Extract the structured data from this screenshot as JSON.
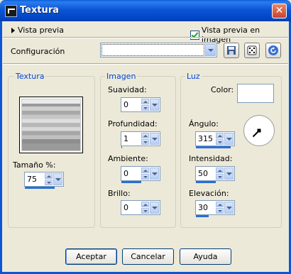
{
  "window": {
    "title": "Textura"
  },
  "header": {
    "preview_label": "Vista previa",
    "image_preview_checkbox_label": "Vista previa en imagen",
    "image_preview_checked": true
  },
  "config": {
    "label": "Configuración",
    "select_value": "",
    "tool_icons": [
      "save-icon",
      "dice-icon",
      "reset-icon"
    ]
  },
  "textura": {
    "title": "Textura",
    "size_label": "Tamaño %:",
    "size_value": "75",
    "size_fraction": 0.75
  },
  "imagen": {
    "title": "Imagen",
    "fields": [
      {
        "label": "Suavidad:",
        "value": "0",
        "fraction": 0
      },
      {
        "label": "Profundidad:",
        "value": "1",
        "fraction": 0.02
      },
      {
        "label": "Ambiente:",
        "value": "0",
        "fraction": 0.5
      },
      {
        "label": "Brillo:",
        "value": "0",
        "fraction": 0
      }
    ]
  },
  "luz": {
    "title": "Luz",
    "color_label": "Color:",
    "color_value": "#ffffff",
    "fields": [
      {
        "label": "Ángulo:",
        "value": "315",
        "fraction": 0.875
      },
      {
        "label": "Intensidad:",
        "value": "50",
        "fraction": 0.5
      },
      {
        "label": "Elevación:",
        "value": "30",
        "fraction": 0.33
      }
    ],
    "dial_angle_deg": 315
  },
  "buttons": {
    "ok": "Aceptar",
    "cancel": "Cancelar",
    "help": "Ayuda"
  },
  "colors": {
    "titlebar": "#0b56d6",
    "group_title": "#0046d5",
    "progress": "#2b6fd4",
    "checkmark": "#21a121"
  }
}
